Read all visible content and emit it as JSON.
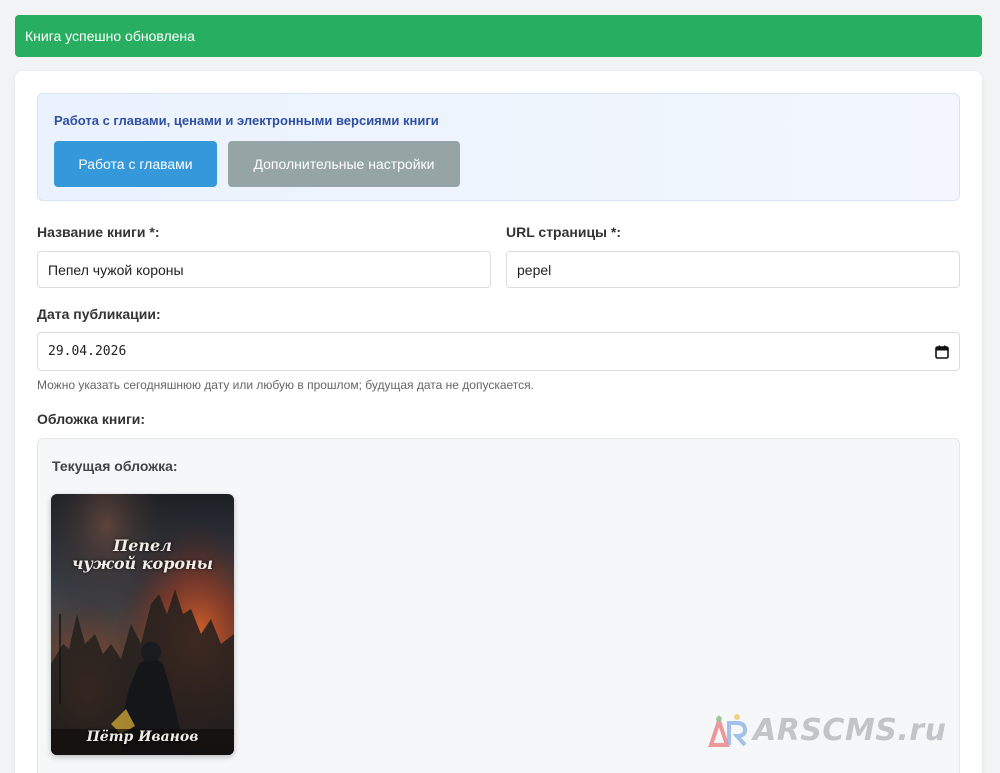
{
  "alert": {
    "message": "Книга успешно обновлена",
    "color": "#27ae60"
  },
  "tools": {
    "title": "Работа с главами, ценами и электронными версиями книги",
    "chapters_button": "Работа с главами",
    "settings_button": "Дополнительные настройки"
  },
  "form": {
    "title_label": "Название книги *:",
    "title_value": "Пепел чужой короны",
    "url_label": "URL страницы *:",
    "url_value": "pepel",
    "date_label": "Дата публикации:",
    "date_value": "29.04.2026",
    "date_hint": "Можно указать сегодняшнюю дату или любую в прошлом; будущая дата не допускается.",
    "cover_label": "Обложка книги:",
    "current_cover_label": "Текущая обложка:"
  },
  "cover": {
    "title_line1": "Пепел",
    "title_line2": "чужой короны",
    "author": "Пётр Иванов"
  },
  "watermark": {
    "text": "ARSCMS.ru"
  },
  "colors": {
    "primary": "#3498db",
    "secondary": "#95a5a6",
    "success": "#27ae60",
    "heading_blue": "#2f4fa2"
  }
}
